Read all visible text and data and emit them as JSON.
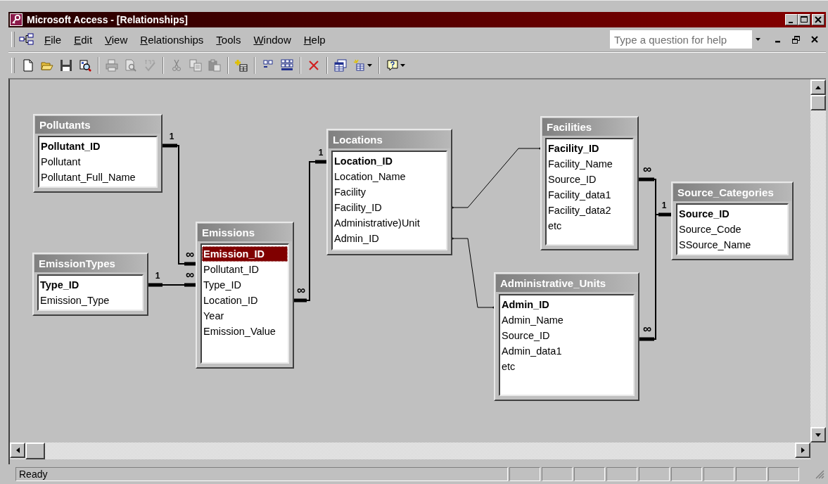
{
  "window": {
    "title": "Microsoft Access - [Relationships]"
  },
  "menu": [
    "File",
    "Edit",
    "View",
    "Relationships",
    "Tools",
    "Window",
    "Help"
  ],
  "help_box": {
    "placeholder": "Type a question for help"
  },
  "toolbar": [
    {
      "kind": "new",
      "disabled": false
    },
    {
      "kind": "open",
      "disabled": false
    },
    {
      "kind": "save",
      "disabled": false
    },
    {
      "kind": "report",
      "disabled": false
    },
    {
      "kind": "separator"
    },
    {
      "kind": "print",
      "disabled": true
    },
    {
      "kind": "preview",
      "disabled": true
    },
    {
      "kind": "spelling",
      "disabled": true
    },
    {
      "kind": "separator"
    },
    {
      "kind": "cut",
      "disabled": true
    },
    {
      "kind": "copy",
      "disabled": true
    },
    {
      "kind": "paste",
      "disabled": true
    },
    {
      "kind": "separator"
    },
    {
      "kind": "show_table",
      "disabled": false
    },
    {
      "kind": "separator"
    },
    {
      "kind": "show_direct",
      "disabled": false
    },
    {
      "kind": "show_all",
      "disabled": false
    },
    {
      "kind": "separator"
    },
    {
      "kind": "delete",
      "disabled": false
    },
    {
      "kind": "separator"
    },
    {
      "kind": "properties",
      "disabled": false
    },
    {
      "kind": "new_object",
      "disabled": false
    },
    {
      "kind": "separator"
    },
    {
      "kind": "help",
      "disabled": false
    }
  ],
  "tables": [
    {
      "title": "Pollutants",
      "fields": [
        {
          "name": "Pollutant_ID",
          "key": true,
          "selected": false
        },
        {
          "name": "Pollutant",
          "key": false,
          "selected": false
        },
        {
          "name": "Pollutant_Full_Name",
          "key": false,
          "selected": false
        }
      ]
    },
    {
      "title": "EmissionTypes",
      "fields": [
        {
          "name": "Type_ID",
          "key": true,
          "selected": false
        },
        {
          "name": "Emission_Type",
          "key": false,
          "selected": false
        }
      ]
    },
    {
      "title": "Emissions",
      "fields": [
        {
          "name": "Emission_ID",
          "key": true,
          "selected": true
        },
        {
          "name": "Pollutant_ID",
          "key": false,
          "selected": false
        },
        {
          "name": "Type_ID",
          "key": false,
          "selected": false
        },
        {
          "name": "Location_ID",
          "key": false,
          "selected": false
        },
        {
          "name": "Year",
          "key": false,
          "selected": false
        },
        {
          "name": "Emission_Value",
          "key": false,
          "selected": false
        }
      ]
    },
    {
      "title": "Locations",
      "fields": [
        {
          "name": "Location_ID",
          "key": true,
          "selected": false
        },
        {
          "name": "Location_Name",
          "key": false,
          "selected": false
        },
        {
          "name": "Facility",
          "key": false,
          "selected": false
        },
        {
          "name": "Facility_ID",
          "key": false,
          "selected": false
        },
        {
          "name": "Administrative)Unit",
          "key": false,
          "selected": false
        },
        {
          "name": "Admin_ID",
          "key": false,
          "selected": false
        }
      ]
    },
    {
      "title": "Facilities",
      "fields": [
        {
          "name": "Facility_ID",
          "key": true,
          "selected": false
        },
        {
          "name": "Facility_Name",
          "key": false,
          "selected": false
        },
        {
          "name": "Source_ID",
          "key": false,
          "selected": false
        },
        {
          "name": "Facility_data1",
          "key": false,
          "selected": false
        },
        {
          "name": "Facility_data2",
          "key": false,
          "selected": false
        },
        {
          "name": "etc",
          "key": false,
          "selected": false
        }
      ]
    },
    {
      "title": "Source_Categories",
      "fields": [
        {
          "name": "Source_ID",
          "key": true,
          "selected": false
        },
        {
          "name": "Source_Code",
          "key": false,
          "selected": false
        },
        {
          "name": "SSource_Name",
          "key": false,
          "selected": false
        }
      ]
    },
    {
      "title": "Administrative_Units",
      "fields": [
        {
          "name": "Admin_ID",
          "key": true,
          "selected": false
        },
        {
          "name": "Admin_Name",
          "key": false,
          "selected": false
        },
        {
          "name": "Source_ID",
          "key": false,
          "selected": false
        },
        {
          "name": "Admin_data1",
          "key": false,
          "selected": false
        },
        {
          "name": "etc",
          "key": false,
          "selected": false
        }
      ]
    }
  ],
  "relationships": [
    {
      "enforced": true,
      "one_mark": "1",
      "many_mark": "∞"
    },
    {
      "enforced": true,
      "one_mark": "1",
      "many_mark": "∞"
    },
    {
      "enforced": true,
      "one_mark": "1",
      "many_mark": "∞"
    },
    {
      "enforced": false
    },
    {
      "enforced": false
    },
    {
      "enforced": true,
      "one_mark": "1",
      "many_mark": "∞"
    },
    {
      "enforced": true,
      "many_mark": "∞"
    }
  ],
  "status_bar": {
    "text": "Ready"
  }
}
